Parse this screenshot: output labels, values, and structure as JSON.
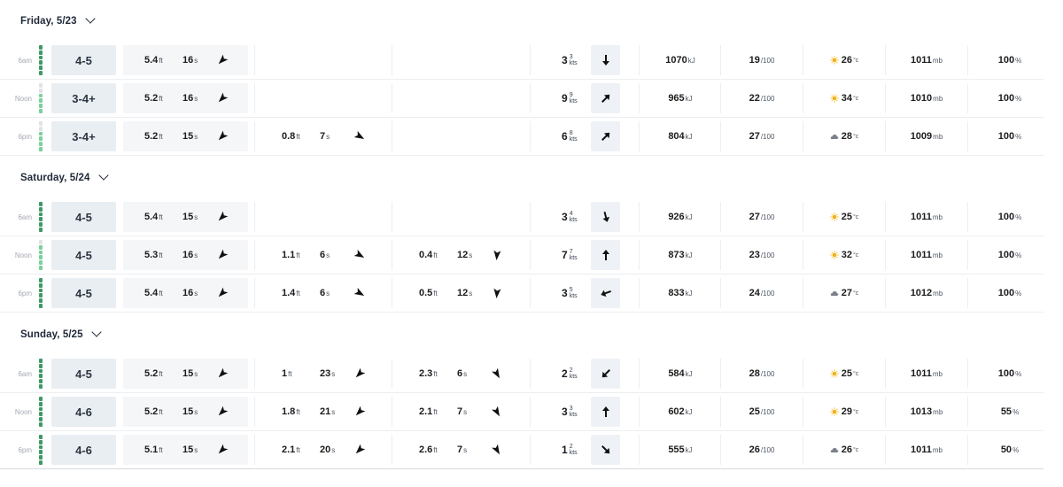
{
  "colors": {
    "bar_on": "#3d9a66",
    "bar_mid": "#7ad19a",
    "bar_off": "#dfe3e7",
    "surf_bg": "#e9eef3",
    "sun": "#f2b31a"
  },
  "units": {
    "ft": "ft",
    "s": "s",
    "kts": "kts",
    "kj": "kJ",
    "rating": "/100",
    "temp": "°c",
    "mb": "mb",
    "pct": "%"
  },
  "days": [
    {
      "title": "Friday, 5/23",
      "rows": [
        {
          "time": "6am",
          "level": 6,
          "surf": "4-5",
          "s1": {
            "ht": "5.4",
            "per": "16",
            "dir": 225,
            "icon": "swell-arrow-icon"
          },
          "s2": null,
          "s3": null,
          "wind": {
            "speed": "3",
            "gust": "3",
            "dir": 180,
            "icon": "arrow-down-icon"
          },
          "energy": "1070",
          "rating": "19",
          "weather": "sun-icon",
          "temp": "26",
          "pressure": "1011",
          "pct": "100"
        },
        {
          "time": "Noon",
          "level": 4,
          "surf": "3-4+",
          "s1": {
            "ht": "5.2",
            "per": "16",
            "dir": 225
          },
          "s2": null,
          "s3": null,
          "wind": {
            "speed": "9",
            "gust": "9",
            "dir": 45,
            "icon": "arrow-up-right-icon"
          },
          "energy": "965",
          "rating": "22",
          "weather": "sun-icon",
          "temp": "34",
          "pressure": "1010",
          "pct": "100"
        },
        {
          "time": "6pm",
          "level": 4,
          "surf": "3-4+",
          "s1": {
            "ht": "5.2",
            "per": "15",
            "dir": 225
          },
          "s2": {
            "ht": "0.8",
            "per": "7",
            "dir": 120
          },
          "s3": null,
          "wind": {
            "speed": "6",
            "gust": "8",
            "dir": 45,
            "icon": "arrow-up-right-icon"
          },
          "energy": "804",
          "rating": "27",
          "weather": "cloud-icon",
          "temp": "28",
          "pressure": "1009",
          "pct": "100"
        }
      ]
    },
    {
      "title": "Saturday, 5/24",
      "rows": [
        {
          "time": "6am",
          "level": 6,
          "surf": "4-5",
          "s1": {
            "ht": "5.4",
            "per": "15",
            "dir": 225
          },
          "s2": null,
          "s3": null,
          "wind": {
            "speed": "3",
            "gust": "4",
            "dir": 165,
            "icon": "arrow-down-icon"
          },
          "energy": "926",
          "rating": "27",
          "weather": "sun-icon",
          "temp": "25",
          "pressure": "1011",
          "pct": "100"
        },
        {
          "time": "Noon",
          "level": 5,
          "surf": "4-5",
          "s1": {
            "ht": "5.3",
            "per": "16",
            "dir": 225
          },
          "s2": {
            "ht": "1.1",
            "per": "6",
            "dir": 120
          },
          "s3": {
            "ht": "0.4",
            "per": "12",
            "dir": 185
          },
          "wind": {
            "speed": "7",
            "gust": "7",
            "dir": 0,
            "icon": "arrow-up-icon"
          },
          "energy": "873",
          "rating": "23",
          "weather": "sun-icon",
          "temp": "32",
          "pressure": "1011",
          "pct": "100"
        },
        {
          "time": "6pm",
          "level": 6,
          "surf": "4-5",
          "s1": {
            "ht": "5.4",
            "per": "16",
            "dir": 225
          },
          "s2": {
            "ht": "1.4",
            "per": "6",
            "dir": 120
          },
          "s3": {
            "ht": "0.5",
            "per": "12",
            "dir": 185
          },
          "wind": {
            "speed": "3",
            "gust": "5",
            "dir": 250,
            "icon": "arrow-left-icon"
          },
          "energy": "833",
          "rating": "24",
          "weather": "cloud-icon",
          "temp": "27",
          "pressure": "1012",
          "pct": "100"
        }
      ]
    },
    {
      "title": "Sunday, 5/25",
      "rows": [
        {
          "time": "6am",
          "level": 6,
          "surf": "4-5",
          "s1": {
            "ht": "5.2",
            "per": "15",
            "dir": 225
          },
          "s2": {
            "ht": "1",
            "per": "23",
            "dir": 225
          },
          "s3": {
            "ht": "2.3",
            "per": "6",
            "dir": 150
          },
          "wind": {
            "speed": "2",
            "gust": "2",
            "dir": 225,
            "icon": "arrow-down-left-icon"
          },
          "energy": "584",
          "rating": "28",
          "weather": "sun-icon",
          "temp": "25",
          "pressure": "1011",
          "pct": "100"
        },
        {
          "time": "Noon",
          "level": 6,
          "surf": "4-6",
          "s1": {
            "ht": "5.2",
            "per": "15",
            "dir": 225
          },
          "s2": {
            "ht": "1.8",
            "per": "21",
            "dir": 225
          },
          "s3": {
            "ht": "2.1",
            "per": "7",
            "dir": 150
          },
          "wind": {
            "speed": "3",
            "gust": "3",
            "dir": 0,
            "icon": "arrow-up-icon"
          },
          "energy": "602",
          "rating": "25",
          "weather": "sun-icon",
          "temp": "29",
          "pressure": "1013",
          "pct": "55"
        },
        {
          "time": "6pm",
          "level": 6,
          "surf": "4-6",
          "s1": {
            "ht": "5.1",
            "per": "15",
            "dir": 225
          },
          "s2": {
            "ht": "2.1",
            "per": "20",
            "dir": 225
          },
          "s3": {
            "ht": "2.6",
            "per": "7",
            "dir": 150
          },
          "wind": {
            "speed": "1",
            "gust": "2",
            "dir": 135,
            "icon": "arrow-down-right-icon"
          },
          "energy": "555",
          "rating": "26",
          "weather": "cloud-icon",
          "temp": "26",
          "pressure": "1011",
          "pct": "50"
        }
      ]
    }
  ]
}
